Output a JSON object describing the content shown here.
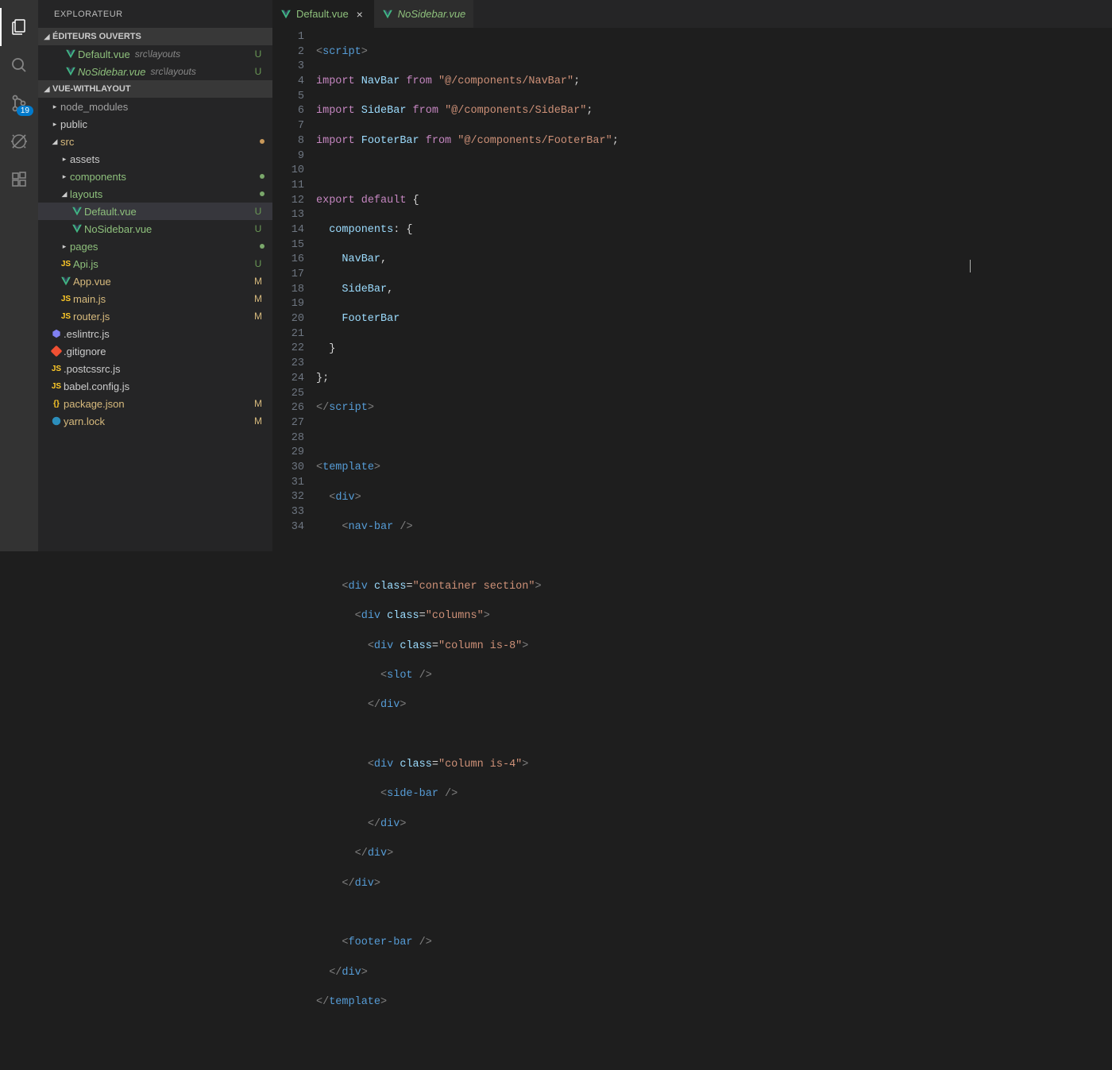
{
  "activity": {
    "badge": "19"
  },
  "sidebar": {
    "title": "EXPLORATEUR",
    "openEditors": {
      "title": "ÉDITEURS OUVERTS",
      "items": [
        {
          "name": "Default.vue",
          "path": "src\\layouts",
          "status": "U"
        },
        {
          "name": "NoSidebar.vue",
          "path": "src\\layouts",
          "status": "U"
        }
      ]
    },
    "project": {
      "title": "VUE-WITHLAYOUT",
      "tree": {
        "node_modules": "node_modules",
        "public": "public",
        "src": "src",
        "assets": "assets",
        "components": "components",
        "layouts": "layouts",
        "default_vue": "Default.vue",
        "nosidebar_vue": "NoSidebar.vue",
        "pages": "pages",
        "api_js": "Api.js",
        "app_vue": "App.vue",
        "main_js": "main.js",
        "router_js": "router.js",
        "eslintrc": ".eslintrc.js",
        "gitignore": ".gitignore",
        "postcssrc": ".postcssrc.js",
        "babel": "babel.config.js",
        "package": "package.json",
        "yarn": "yarn.lock"
      },
      "status": {
        "default_vue": "U",
        "nosidebar_vue": "U",
        "api_js": "U",
        "app_vue": "M",
        "main_js": "M",
        "router_js": "M",
        "package": "M",
        "yarn": "M"
      }
    }
  },
  "tabs": [
    {
      "name": "Default.vue",
      "active": true
    },
    {
      "name": "NoSidebar.vue",
      "active": false
    }
  ],
  "code": {
    "lines": 34
  }
}
